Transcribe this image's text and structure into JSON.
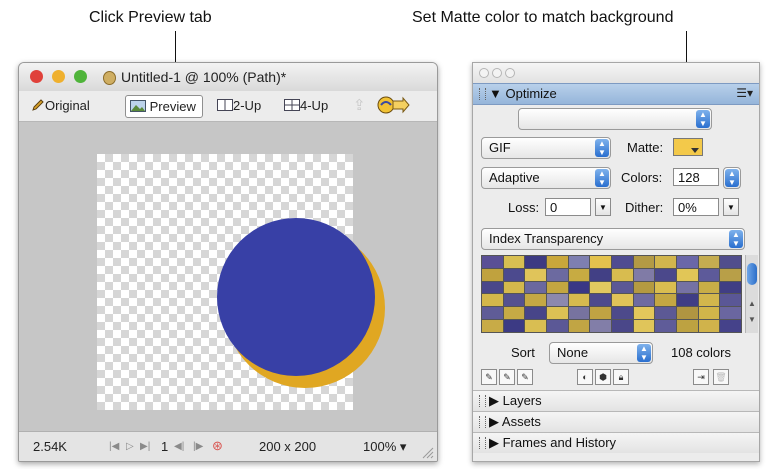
{
  "callouts": {
    "preview_tab": "Click Preview tab",
    "matte_color": "Set Matte color to match background"
  },
  "document_window": {
    "title": "Untitled-1 @ 100% (Path)*",
    "traffic_lights": {
      "close": "#e0413a",
      "minimize": "#efb02e",
      "zoom": "#4fb43a"
    },
    "tabs": {
      "original": "Original",
      "preview": "Preview",
      "two_up": "2-Up",
      "four_up": "4-Up"
    },
    "canvas": {
      "circle_color": "#3840a6",
      "shadow_color": "#e0a722"
    },
    "status": {
      "file_size": "2.54K",
      "frame": "1",
      "dimensions": "200 x 200",
      "zoom": "100%"
    }
  },
  "optimize_panel": {
    "header": "Optimize",
    "settings_value": "",
    "format": "GIF",
    "matte_label": "Matte:",
    "matte_color": "#f3c94a",
    "palette_type": "Adaptive",
    "colors_label": "Colors:",
    "colors_value": "128",
    "loss_label": "Loss:",
    "loss_value": "0",
    "dither_label": "Dither:",
    "dither_value": "0%",
    "transparency": "Index Transparency",
    "palette_swatches": [
      "#5a4f95",
      "#d8bf52",
      "#3d3a82",
      "#c9a73b",
      "#7e7fb0",
      "#e3c24d",
      "#4f4c91",
      "#b39a45",
      "#d1b54d",
      "#6a67a8",
      "#c4ac50",
      "#514e8c",
      "#c0a23e",
      "#4c4a8e",
      "#e0c45a",
      "#6c6aa0",
      "#c7ab42",
      "#424085",
      "#d8bc4f",
      "#807ba6",
      "#4b488b",
      "#e1c657",
      "#5d5a9a",
      "#b89f48",
      "#4a478a",
      "#d4b84c",
      "#6b689f",
      "#c3a641",
      "#393785",
      "#e2c960",
      "#5b5895",
      "#b49a41",
      "#d9bd50",
      "#7572a4",
      "#c8ad47",
      "#403e84",
      "#d3b74b",
      "#545190",
      "#c4a844",
      "#8c88ae",
      "#d6ba4e",
      "#4d4a8c",
      "#e0c358",
      "#6e6ba1",
      "#c3a743",
      "#3f3d85",
      "#d2b64c",
      "#5a5796",
      "#5f5c97",
      "#c6aa45",
      "#474589",
      "#dcc154",
      "#77739f",
      "#c0a343",
      "#4d4a8b",
      "#e3c75b",
      "#5c5995",
      "#b09541",
      "#d1b54a",
      "#6a66a0",
      "#c8ab47",
      "#3c3a84",
      "#d9be52",
      "#5b5896",
      "#c1a544",
      "#827ea8",
      "#4a4789",
      "#e0c55a",
      "#5f5c99",
      "#bda241",
      "#d0b34b",
      "#45428a"
    ],
    "sort_label": "Sort",
    "sort_value": "None",
    "colors_count": "108 colors",
    "sections": {
      "layers": "Layers",
      "assets": "Assets",
      "frames": "Frames and History"
    }
  }
}
